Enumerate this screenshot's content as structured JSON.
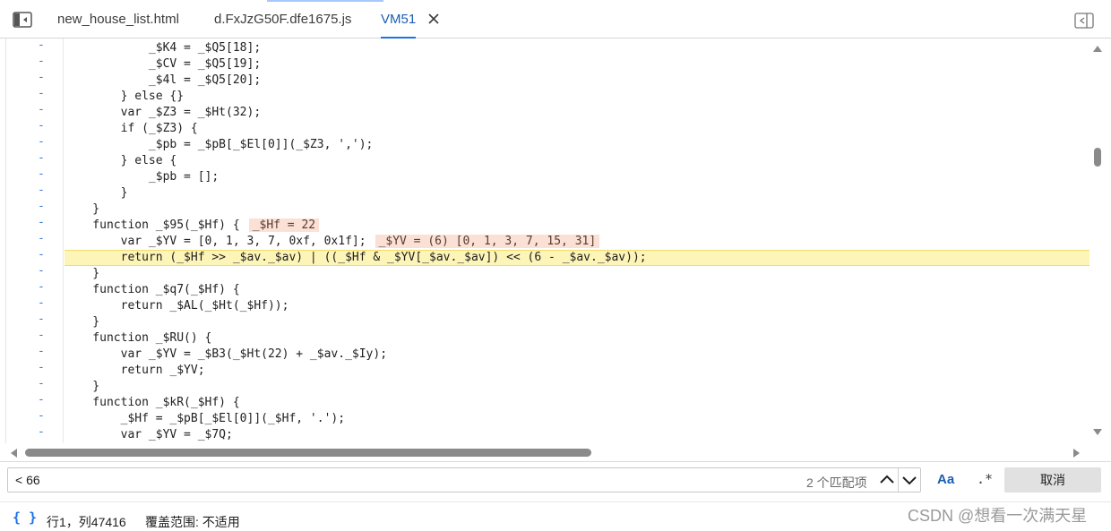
{
  "tabs": [
    {
      "label": "new_house_list.html",
      "active": false
    },
    {
      "label": "d.FxJzG50F.dfe1675.js",
      "active": false
    },
    {
      "label": "VM51",
      "active": true
    }
  ],
  "icons": {
    "navigator_toggle": "sidebar-toggle-icon",
    "tab_close": "close-icon",
    "debugger_toggle": "panel-toggle-icon",
    "find_prev": "chevron-up-icon",
    "find_next": "chevron-down-icon",
    "format": "curly-braces-icon"
  },
  "gutter_marker": "-",
  "code_lines": [
    "            _$K4 = _$Q5[18];",
    "            _$CV = _$Q5[19];",
    "            _$4l = _$Q5[20];",
    "        } else {}",
    "        var _$Z3 = _$Ht(32);",
    "        if (_$Z3) {",
    "            _$pb = _$pB[_$El[0]](_$Z3, ',');",
    "        } else {",
    "            _$pb = [];",
    "        }",
    "    }",
    "    function _$95(_$Hf) {",
    "        var _$YV = [0, 1, 3, 7, 0xf, 0x1f];",
    "        return (_$Hf >> _$av._$av) | ((_$Hf & _$YV[_$av._$av]) << (6 - _$av._$av));",
    "    }",
    "    function _$q7(_$Hf) {",
    "        return _$AL(_$Ht(_$Hf));",
    "    }",
    "    function _$RU() {",
    "        var _$YV = _$B3(_$Ht(22) + _$av._$Iy);",
    "        return _$YV;",
    "    }",
    "    function _$kR(_$Hf) {",
    "        _$Hf = _$pB[_$El[0]](_$Hf, '.');",
    "        var _$YV = _$7Q;"
  ],
  "inline_values": {
    "hf": "_$Hf = 22",
    "yv": "_$YV = (6) [0, 1, 3, 7, 15, 31]"
  },
  "search": {
    "value": "< 66",
    "match_count": "2 个匹配项",
    "case_label": "Aa",
    "regex_label": ".*",
    "cancel_label": "取消"
  },
  "status": {
    "format_label": "{ }",
    "position": "行1，列47416",
    "coverage": "覆盖范围: 不适用"
  },
  "watermark": "CSDN @想看一次满天星",
  "colors": {
    "accent": "#1a73e8",
    "exec_line": "#fdf4b8",
    "inline_value_bg": "#fbe0d5",
    "gutter_marker": "#3a7bd5"
  }
}
